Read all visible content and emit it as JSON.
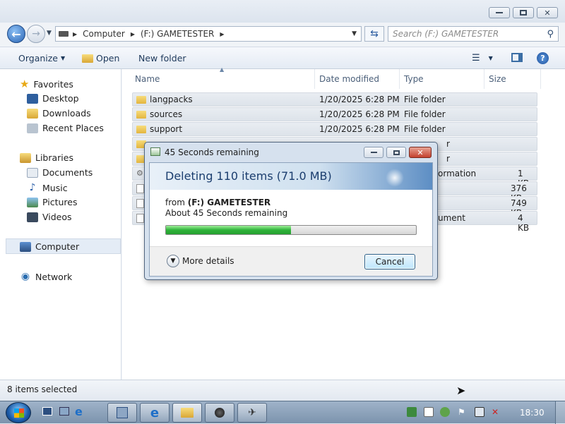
{
  "window": {
    "breadcrumb": [
      "Computer",
      "(F:) GAMETESTER"
    ],
    "search_placeholder": "Search (F:) GAMETESTER"
  },
  "toolbar": {
    "organize": "Organize",
    "open": "Open",
    "new_folder": "New folder"
  },
  "nav": {
    "favorites": "Favorites",
    "desktop": "Desktop",
    "downloads": "Downloads",
    "recent": "Recent Places",
    "libraries": "Libraries",
    "documents": "Documents",
    "music": "Music",
    "pictures": "Pictures",
    "videos": "Videos",
    "computer": "Computer",
    "network": "Network"
  },
  "columns": {
    "name": "Name",
    "date": "Date modified",
    "type": "Type",
    "size": "Size"
  },
  "rows": [
    {
      "name": "langpacks",
      "date": "1/20/2025 6:28 PM",
      "type": "File folder",
      "size": ""
    },
    {
      "name": "sources",
      "date": "1/20/2025 6:28 PM",
      "type": "File folder",
      "size": ""
    },
    {
      "name": "support",
      "date": "1/20/2025 6:28 PM",
      "type": "File folder",
      "size": ""
    },
    {
      "name": "",
      "date": "",
      "type": "r",
      "size": ""
    },
    {
      "name": "",
      "date": "",
      "type": "r",
      "size": ""
    },
    {
      "name": "",
      "date": "",
      "type": "ormation",
      "size": "1 KB"
    },
    {
      "name": "",
      "date": "",
      "type": "",
      "size": "376 KB"
    },
    {
      "name": "",
      "date": "",
      "type": "",
      "size": "749 KB"
    },
    {
      "name": "",
      "date": "",
      "type": "ument",
      "size": "4 KB"
    }
  ],
  "status": {
    "text": "8 items selected"
  },
  "dialog": {
    "title": "45 Seconds remaining",
    "heading": "Deleting 110 items (71.0 MB)",
    "from_prefix": "from",
    "from_location": "(F:) GAMETESTER",
    "remaining": "About 45 Seconds remaining",
    "progress": 0.5,
    "more_details": "More details",
    "cancel": "Cancel"
  },
  "taskbar": {
    "clock": "18:30"
  }
}
